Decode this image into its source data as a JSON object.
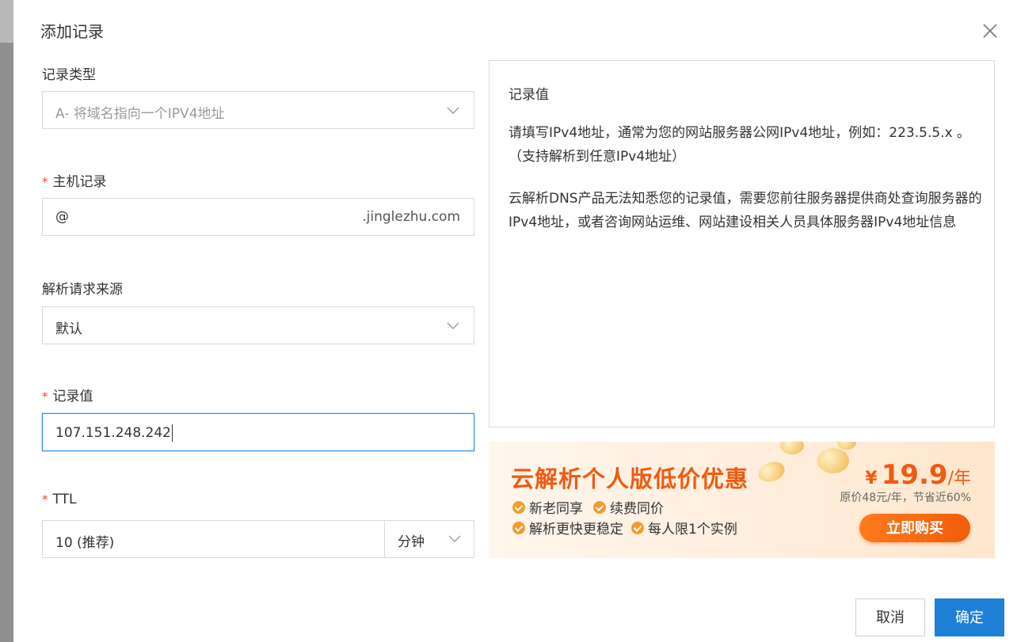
{
  "dialog": {
    "title": "添加记录"
  },
  "form": {
    "record_type": {
      "label": "记录类型",
      "value": "A- 将域名指向一个IPV4地址"
    },
    "host": {
      "required_mark": "*",
      "label": "主机记录",
      "value": "@",
      "suffix": ".jinglezhu.com"
    },
    "source": {
      "label": "解析请求来源",
      "value": "默认"
    },
    "record_value": {
      "required_mark": "*",
      "label": "记录值",
      "value": "107.151.248.242"
    },
    "ttl": {
      "required_mark": "*",
      "label": "TTL",
      "value": "10 (推荐)",
      "unit": "分钟"
    }
  },
  "help": {
    "title": "记录值",
    "para1": "请填写IPv4地址，通常为您的网站服务器公网IPv4地址，例如：223.5.5.x 。（支持解析到任意IPv4地址）",
    "para2": "云解析DNS产品无法知悉您的记录值，需要您前往服务器提供商处查询服务器的IPv4地址，或者咨询网站运维、网站建设相关人员具体服务器IPv4地址信息"
  },
  "promo": {
    "title": "云解析个人版低价优惠",
    "features": [
      "新老同享",
      "续费同价",
      "解析更快更稳定",
      "每人限1个实例"
    ],
    "currency": "¥",
    "price": "19.9",
    "per": "/年",
    "original": "原价48元/年，节省近60%",
    "buy_label": "立即购买"
  },
  "buttons": {
    "cancel": "取消",
    "ok": "确定"
  },
  "colors": {
    "primary": "#1d80d6",
    "required": "#f04134",
    "promo_accent": "#f05a12",
    "focus_border": "#2f8ee6"
  }
}
